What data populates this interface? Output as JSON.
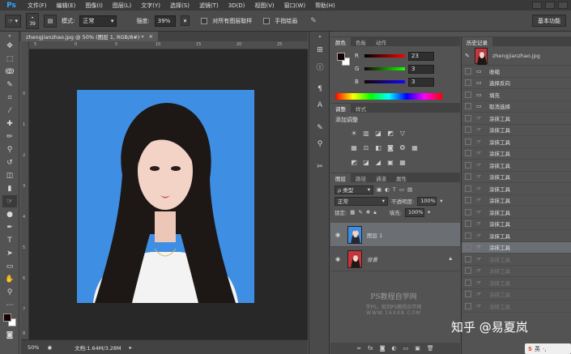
{
  "app": {
    "logo": "Ps",
    "accent": "#31a8ff"
  },
  "menubar": {
    "items": [
      "文件(F)",
      "编辑(E)",
      "图像(I)",
      "图层(L)",
      "文字(Y)",
      "选择(S)",
      "滤镜(T)",
      "3D(D)",
      "视图(V)",
      "窗口(W)",
      "帮助(H)"
    ]
  },
  "options": {
    "brush_size": "39",
    "mode_label": "模式:",
    "mode_value": "正常",
    "strength_label": "强度:",
    "strength_value": "39%",
    "sample_all_layers": "对所有图层取样",
    "finger_paint": "手指绘画",
    "workspace": "基本功能"
  },
  "document": {
    "tab_title": "zhengjianzhao.jpg @ 50% (图层 1, RGB/8#) *",
    "ruler_top": [
      "5",
      "0",
      "5",
      "10",
      "15",
      "20",
      "25"
    ],
    "ruler_left": [
      "0",
      "1",
      "2",
      "3",
      "4",
      "5",
      "6",
      "7",
      "8"
    ],
    "status_zoom": "50%",
    "status_doc": "文档:1.64M/3.28M"
  },
  "color_panel": {
    "tabs": [
      "颜色",
      "色板",
      "动作"
    ],
    "channels": [
      {
        "label": "R",
        "value": "23"
      },
      {
        "label": "G",
        "value": "3"
      },
      {
        "label": "B",
        "value": "3"
      }
    ],
    "foreground": "#170303",
    "background": "#ffffff"
  },
  "adjust_panel": {
    "tabs": [
      "调整",
      "样式"
    ],
    "title": "添加调整",
    "row1_icons": [
      "☀",
      "▥",
      "◪",
      "◩",
      "▽"
    ],
    "row2_icons": [
      "▦",
      "⚖",
      "◧",
      "◙",
      "❂",
      "▦"
    ],
    "row3_icons": [
      "◩",
      "◪",
      "◢",
      "▣",
      "▦"
    ]
  },
  "layers_panel": {
    "tabs": [
      "图层",
      "路径",
      "通道",
      "属性"
    ],
    "filter_label": "ρ 类型",
    "blend_mode": "正常",
    "opacity_label": "不透明度:",
    "opacity_value": "100%",
    "lock_label": "锁定:",
    "fill_label": "填充:",
    "fill_value": "100%",
    "layers": [
      {
        "name": "图层 1",
        "selected": true
      },
      {
        "name": "背景",
        "selected": false
      }
    ],
    "watermark_line1": "PS教程自学网",
    "watermark_line2": "学PS，就到PS教程自学网",
    "watermark_line3": "WWW.16XX8.COM"
  },
  "history_panel": {
    "tab": "历史记录",
    "snapshot_name": "zhengjianzhao.jpg",
    "items": [
      {
        "label": "收缩",
        "state": "normal",
        "icon": "▭"
      },
      {
        "label": "选择反向",
        "state": "normal",
        "icon": "▭"
      },
      {
        "label": "填充",
        "state": "normal",
        "icon": "▭"
      },
      {
        "label": "取消选择",
        "state": "normal",
        "icon": "▭"
      },
      {
        "label": "涂抹工具",
        "state": "normal",
        "icon": "☞"
      },
      {
        "label": "涂抹工具",
        "state": "normal",
        "icon": "☞"
      },
      {
        "label": "涂抹工具",
        "state": "normal",
        "icon": "☞"
      },
      {
        "label": "涂抹工具",
        "state": "normal",
        "icon": "☞"
      },
      {
        "label": "涂抹工具",
        "state": "normal",
        "icon": "☞"
      },
      {
        "label": "涂抹工具",
        "state": "normal",
        "icon": "☞"
      },
      {
        "label": "涂抹工具",
        "state": "normal",
        "icon": "☞"
      },
      {
        "label": "涂抹工具",
        "state": "normal",
        "icon": "☞"
      },
      {
        "label": "涂抹工具",
        "state": "normal",
        "icon": "☞"
      },
      {
        "label": "涂抹工具",
        "state": "normal",
        "icon": "☞"
      },
      {
        "label": "涂抹工具",
        "state": "normal",
        "icon": "☞"
      },
      {
        "label": "涂抹工具",
        "state": "active",
        "icon": "☞"
      },
      {
        "label": "涂抹工具",
        "state": "dim",
        "icon": "☞"
      },
      {
        "label": "涂抹工具",
        "state": "dim",
        "icon": "☞"
      },
      {
        "label": "涂抹工具",
        "state": "dim",
        "icon": "☞"
      },
      {
        "label": "涂抹工具",
        "state": "dim",
        "icon": "☞"
      },
      {
        "label": "涂抹工具",
        "state": "dim",
        "icon": "☞"
      }
    ]
  },
  "overlay": {
    "zhihu_watermark": "知乎 @易夏岚",
    "ime_label": "英"
  },
  "photo": {
    "background_color": "#3e8fe3"
  }
}
